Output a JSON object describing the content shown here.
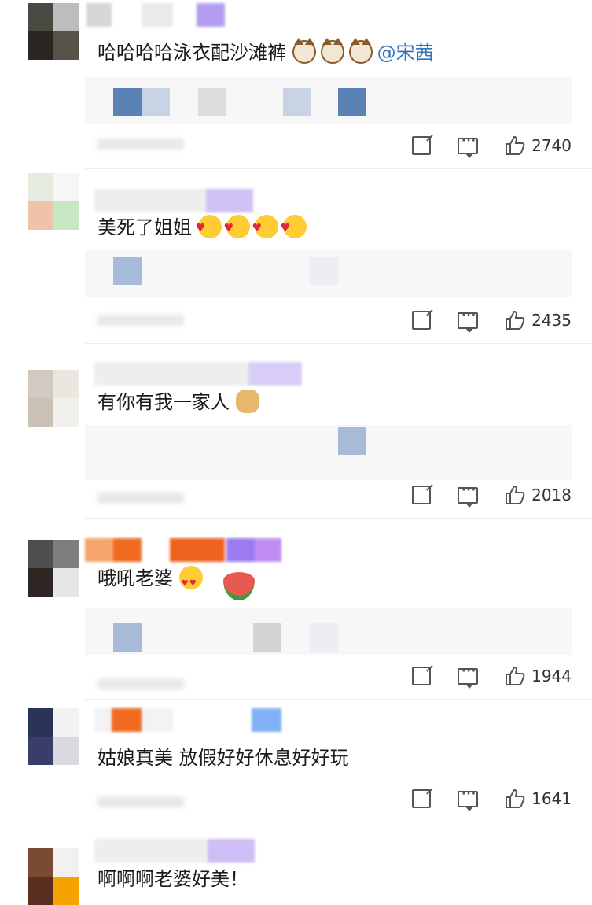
{
  "comments": [
    {
      "text": "哈哈哈哈泳衣配沙滩裤",
      "emojis": [
        "cat-emoji",
        "cat-emoji",
        "cat-emoji"
      ],
      "mention": "@宋茜",
      "likes": "2740"
    },
    {
      "text": "美死了姐姐",
      "emojis": [
        "kiss-emoji",
        "kiss-emoji",
        "kiss-emoji",
        "kiss-emoji"
      ],
      "likes": "2435"
    },
    {
      "text": "有你有我一家人",
      "emojis": [
        "doge-emoji"
      ],
      "likes": "2018"
    },
    {
      "text": "哦吼老婆",
      "emojis": [
        "heart-eyes-emoji",
        "watermelon-emoji"
      ],
      "likes": "1944"
    },
    {
      "text": "姑娘真美 放假好好休息好好玩",
      "emojis": [],
      "likes": "1641"
    },
    {
      "text": "啊啊啊老婆好美！",
      "emojis": [],
      "likes": ""
    }
  ],
  "badges": {
    "fan_level": "铁粉2"
  },
  "colors": {
    "mention": "#3b73b9",
    "badge": "#b69cf2"
  }
}
